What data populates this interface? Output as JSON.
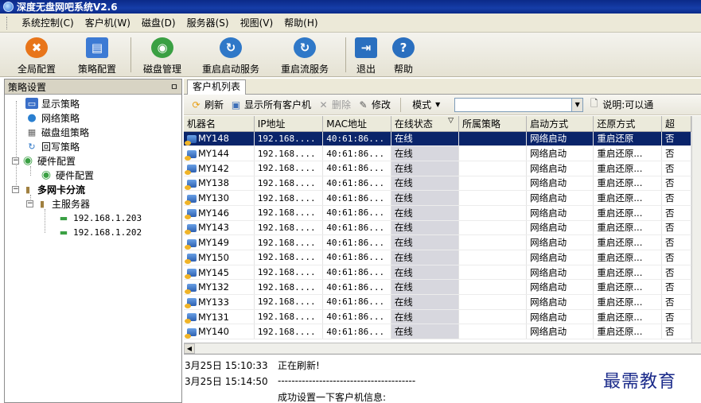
{
  "window": {
    "title": "深度无盘网吧系统V2.6"
  },
  "menu": [
    "系统控制(C)",
    "客户机(W)",
    "磁盘(D)",
    "服务器(S)",
    "视图(V)",
    "帮助(H)"
  ],
  "toolbar": [
    {
      "label": "全局配置",
      "icon": "global-config-icon",
      "color": "#e8751a"
    },
    {
      "label": "策略配置",
      "icon": "policy-config-icon",
      "color": "#3c7ad4"
    },
    {
      "label": "磁盘管理",
      "icon": "disk-manage-icon",
      "color": "#3aa043"
    },
    {
      "label": "重启启动服务",
      "icon": "restart-boot-service-icon",
      "color": "#2f78c8"
    },
    {
      "label": "重启流服务",
      "icon": "restart-stream-service-icon",
      "color": "#2f78c8"
    },
    {
      "label": "退出",
      "icon": "exit-icon",
      "color": "#2a6fbf"
    },
    {
      "label": "帮助",
      "icon": "help-icon",
      "color": "#2a6fbf"
    }
  ],
  "left_pane": {
    "title": "策略设置",
    "pin": "ㅁ",
    "tree": {
      "display": "显示策略",
      "network": "网络策略",
      "disk_group": "磁盘组策略",
      "writeback": "回写策略",
      "hardware": "硬件配置",
      "hardware_child": "硬件配置",
      "multi_nic": "多网卡分流",
      "main_server": "主服务器",
      "ip1": "192.168.1.203",
      "ip2": "192.168.1.202"
    }
  },
  "right_pane": {
    "tab": "客户机列表",
    "sub_toolbar": {
      "refresh": "刷新",
      "show_all": "显示所有客户机",
      "delete": "删除",
      "modify": "修改",
      "mode": "模式",
      "search_value": "",
      "hint": "说明:可以通"
    },
    "columns": [
      "机器名",
      "IP地址",
      "MAC地址",
      "在线状态",
      "所属策略",
      "启动方式",
      "还原方式",
      "超"
    ],
    "rows": [
      [
        "MY148",
        "192.168....",
        "40:61:86...",
        "在线",
        "",
        "网络启动",
        "重启还原",
        "否"
      ],
      [
        "MY144",
        "192.168....",
        "40:61:86...",
        "在线",
        "",
        "网络启动",
        "重启还原...",
        "否"
      ],
      [
        "MY142",
        "192.168....",
        "40:61:86...",
        "在线",
        "",
        "网络启动",
        "重启还原...",
        "否"
      ],
      [
        "MY138",
        "192.168....",
        "40:61:86...",
        "在线",
        "",
        "网络启动",
        "重启还原...",
        "否"
      ],
      [
        "MY130",
        "192.168....",
        "40:61:86...",
        "在线",
        "",
        "网络启动",
        "重启还原...",
        "否"
      ],
      [
        "MY146",
        "192.168....",
        "40:61:86...",
        "在线",
        "",
        "网络启动",
        "重启还原...",
        "否"
      ],
      [
        "MY143",
        "192.168....",
        "40:61:86...",
        "在线",
        "",
        "网络启动",
        "重启还原...",
        "否"
      ],
      [
        "MY149",
        "192.168....",
        "40:61:86...",
        "在线",
        "",
        "网络启动",
        "重启还原...",
        "否"
      ],
      [
        "MY150",
        "192.168....",
        "40:61:86...",
        "在线",
        "",
        "网络启动",
        "重启还原...",
        "否"
      ],
      [
        "MY145",
        "192.168....",
        "40:61:86...",
        "在线",
        "",
        "网络启动",
        "重启还原...",
        "否"
      ],
      [
        "MY132",
        "192.168....",
        "40:61:86...",
        "在线",
        "",
        "网络启动",
        "重启还原...",
        "否"
      ],
      [
        "MY133",
        "192.168....",
        "40:61:86...",
        "在线",
        "",
        "网络启动",
        "重启还原...",
        "否"
      ],
      [
        "MY131",
        "192.168....",
        "40:61:86...",
        "在线",
        "",
        "网络启动",
        "重启还原...",
        "否"
      ],
      [
        "MY140",
        "192.168....",
        "40:61:86...",
        "在线",
        "",
        "网络启动",
        "重启还原...",
        "否"
      ]
    ],
    "log": [
      {
        "time": "3月25日 15:10:33",
        "msg": "正在刷新!"
      },
      {
        "time": "3月25日 15:14:50",
        "msg": "----------------------------------------"
      },
      {
        "time": "",
        "msg": "成功设置一下客户机信息:"
      }
    ]
  },
  "watermark": "最需教育",
  "colors": {
    "title_bar": "#0b2a88",
    "selection": "#0a246a",
    "status_column": "#d7d7de"
  }
}
